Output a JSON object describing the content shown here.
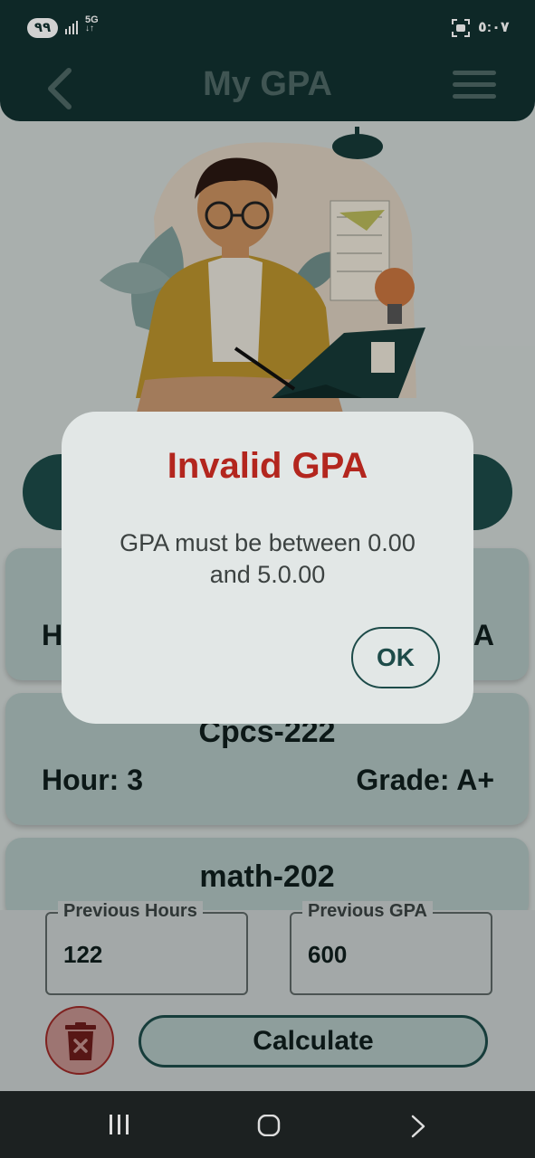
{
  "status_bar": {
    "battery": "٩٩",
    "network": "5G",
    "time": "٥:٠٧"
  },
  "app_bar": {
    "title": "My GPA",
    "back_icon": "chevron-left-icon",
    "menu_icon": "hamburger-menu-icon"
  },
  "courses": [
    {
      "name": "",
      "hour": "H",
      "grade": "A"
    },
    {
      "name": "Cpcs-222",
      "hour": "Hour: 3",
      "grade": "Grade: A+"
    },
    {
      "name": "math-202",
      "hour": "",
      "grade": ""
    }
  ],
  "inputs": {
    "previous_hours": {
      "label": "Previous Hours",
      "value": "122"
    },
    "previous_gpa": {
      "label": "Previous GPA",
      "value": "600"
    }
  },
  "actions": {
    "calculate_label": "Calculate",
    "delete_icon": "trash-icon"
  },
  "dialog": {
    "title": "Invalid GPA",
    "message": "GPA must be between 0.00 and 5.0.00",
    "ok_label": "OK"
  },
  "colors": {
    "primary": "#123130",
    "accent": "#1d4b49",
    "error": "#b3261e",
    "card": "#aec1bf"
  }
}
